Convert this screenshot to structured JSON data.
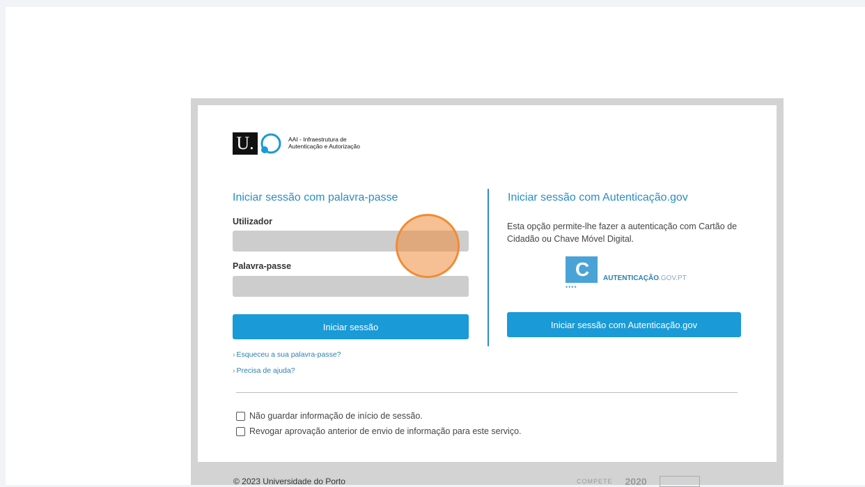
{
  "logo": {
    "mark": "U.",
    "line1": "AAI - Infraestrutura de",
    "line2": "Autenticação e Autorização"
  },
  "password_login": {
    "title": "Iniciar sessão com palavra-passe",
    "username_label": "Utilizador",
    "username_value": "",
    "password_label": "Palavra-passe",
    "password_value": "",
    "submit_label": "Iniciar sessão",
    "forgot_link": "Esqueceu a sua palavra-passe?",
    "help_link": "Precisa de ajuda?"
  },
  "gov_login": {
    "title": "Iniciar sessão com Autenticação.gov",
    "description": "Esta opção permite-lhe fazer a autenticação com Cartão de Cidadão ou Chave Móvel Digital.",
    "logo_bold": "AUTENTICAÇÃO",
    "logo_light": ".GOV.PT",
    "submit_label": "Iniciar sessão com Autenticação.gov"
  },
  "options": {
    "no_save_label": "Não guardar informação de início de sessão.",
    "revoke_label": "Revogar aprovação anterior de envio de informação para este serviço."
  },
  "footer": {
    "copyright": "© 2023 Universidade do Porto",
    "compete": "COMPETE",
    "portugal": "2020"
  },
  "colors": {
    "accent": "#2a8dc5",
    "button": "#1a9ad6",
    "input_bg": "#cdcdcd",
    "frame": "#d3d3d3",
    "cursor": "#ef8c33"
  }
}
